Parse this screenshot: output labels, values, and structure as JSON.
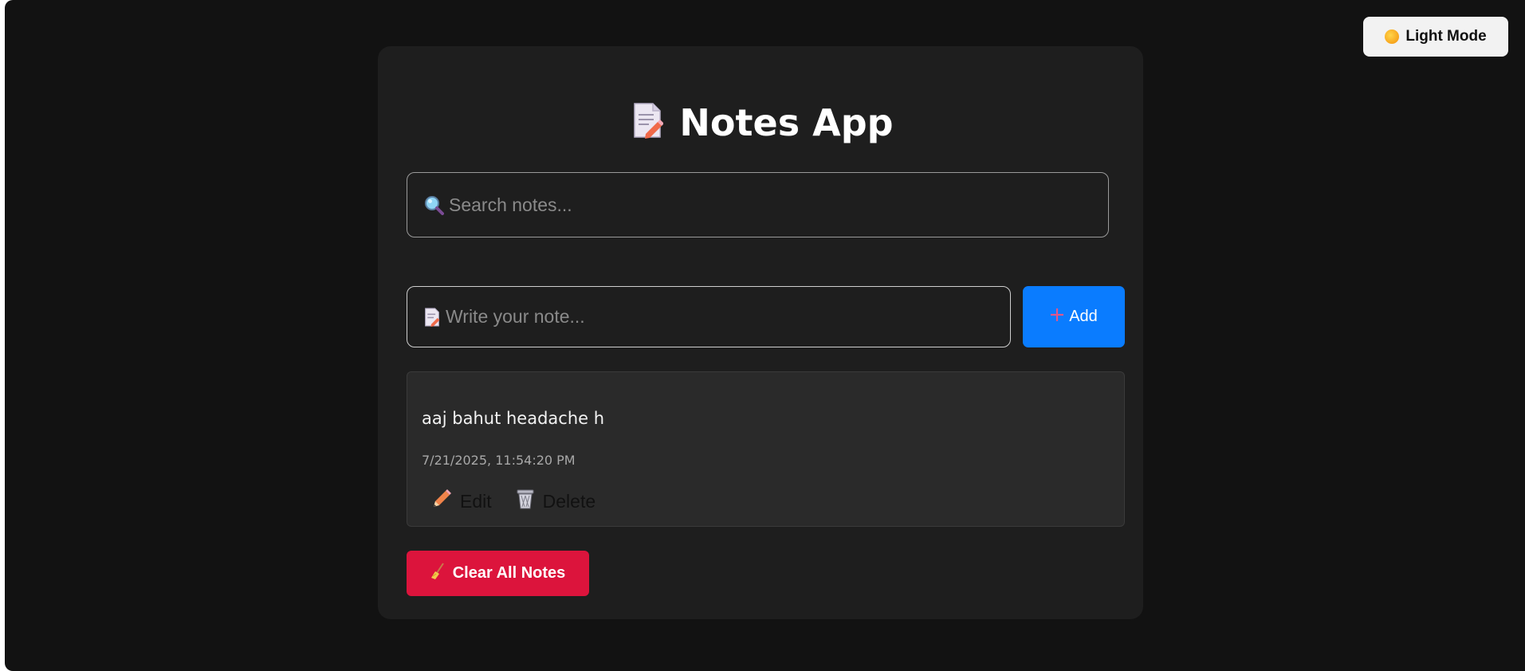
{
  "theme_toggle": {
    "label": "Light Mode",
    "icon": "sun-icon"
  },
  "app": {
    "title": "Notes App",
    "title_icon": "memo-icon"
  },
  "search": {
    "placeholder": "Search notes...",
    "value": "",
    "icon": "magnifier-icon"
  },
  "composer": {
    "placeholder": "Write your note...",
    "value": "",
    "icon": "memo-icon",
    "add_label": "Add",
    "add_icon": "plus-icon"
  },
  "notes": [
    {
      "text": "aaj bahut headache h",
      "timestamp": "7/21/2025, 11:54:20 PM",
      "edit_label": "Edit",
      "delete_label": "Delete"
    }
  ],
  "clear_all": {
    "label": "Clear All Notes",
    "icon": "broom-icon"
  },
  "colors": {
    "page_bg": "#121212",
    "card_bg": "#1e1e1e",
    "note_bg": "#2a2a2a",
    "add_button": "#0a7cff",
    "clear_button": "#dc143c"
  }
}
